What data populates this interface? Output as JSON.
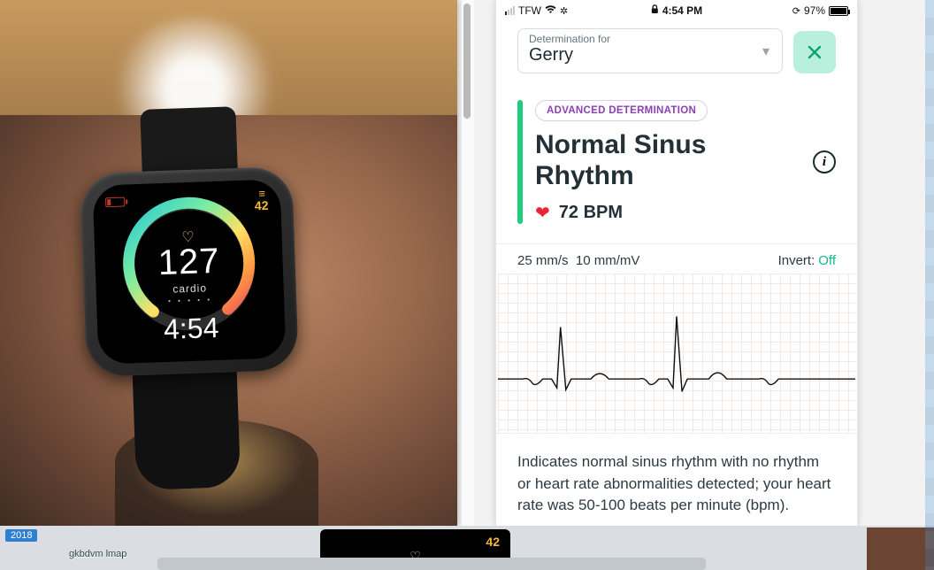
{
  "watch": {
    "heart_rate": "127",
    "zone": "cardio",
    "time": "4:54",
    "steps": "42",
    "dots": "• • • • •"
  },
  "phone": {
    "status": {
      "carrier": "TFW",
      "time": "4:54 PM",
      "battery_pct": "97%"
    },
    "select": {
      "label": "Determination for",
      "value": "Gerry"
    },
    "pill": "ADVANCED DETERMINATION",
    "diagnosis": "Normal Sinus Rhythm",
    "bpm": "72 BPM",
    "ecg": {
      "speed": "25 mm/s",
      "gain": "10 mm/mV",
      "invert_label": "Invert:",
      "invert_value": "Off"
    },
    "description": "Indicates normal sinus rhythm with no rhythm or heart rate abnormalities detected; your heart rate was 50-100 beats per minute (bpm)."
  },
  "bottom": {
    "year": "2018",
    "tag": "gkbdvm lmap",
    "thumb_steps": "42"
  }
}
